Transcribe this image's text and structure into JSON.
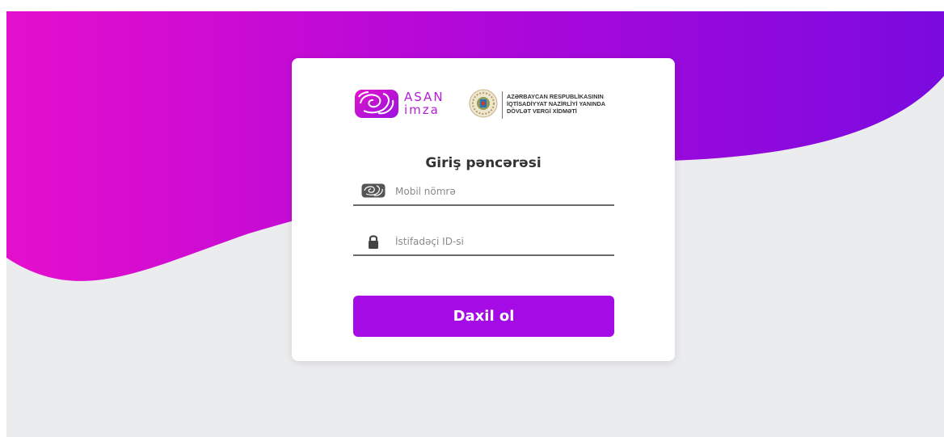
{
  "brand": {
    "logo_line1": "ASAN",
    "logo_line2": "imza",
    "agency_line1": "AZƏRBAYCAN RESPUBLİKASININ",
    "agency_line2": "İQTİSADİYYAT NAZİRLİYİ YANINDA",
    "agency_line3": "DÖVLƏT VERGİ XİDMƏTİ"
  },
  "login": {
    "title": "Giriş pəncərəsi",
    "mobile_placeholder": "Mobil nömrə",
    "mobile_value": "",
    "user_id_placeholder": "İstifadəçi ID-si",
    "user_id_value": "",
    "submit_label": "Daxil ol"
  },
  "icons": {
    "mobile": "asan-fingerprint-icon",
    "user_id": "lock-icon",
    "brand": "asan-imza-logo-icon",
    "agency": "state-emblem-icon"
  },
  "colors": {
    "gradient_start": "#e50fcd",
    "gradient_end": "#7a0adf",
    "button": "#a50ce5",
    "background": "#ebecee",
    "card": "#ffffff"
  }
}
